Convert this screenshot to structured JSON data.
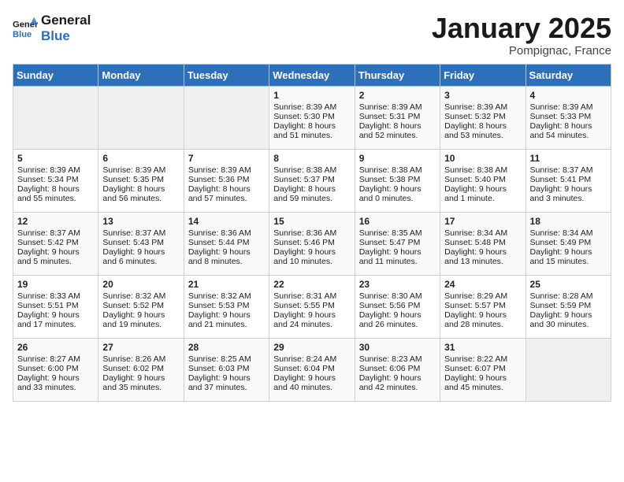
{
  "header": {
    "logo_line1": "General",
    "logo_line2": "Blue",
    "month": "January 2025",
    "location": "Pompignac, France"
  },
  "days_of_week": [
    "Sunday",
    "Monday",
    "Tuesday",
    "Wednesday",
    "Thursday",
    "Friday",
    "Saturday"
  ],
  "weeks": [
    [
      {
        "day": "",
        "info": ""
      },
      {
        "day": "",
        "info": ""
      },
      {
        "day": "",
        "info": ""
      },
      {
        "day": "1",
        "info": "Sunrise: 8:39 AM\nSunset: 5:30 PM\nDaylight: 8 hours\nand 51 minutes."
      },
      {
        "day": "2",
        "info": "Sunrise: 8:39 AM\nSunset: 5:31 PM\nDaylight: 8 hours\nand 52 minutes."
      },
      {
        "day": "3",
        "info": "Sunrise: 8:39 AM\nSunset: 5:32 PM\nDaylight: 8 hours\nand 53 minutes."
      },
      {
        "day": "4",
        "info": "Sunrise: 8:39 AM\nSunset: 5:33 PM\nDaylight: 8 hours\nand 54 minutes."
      }
    ],
    [
      {
        "day": "5",
        "info": "Sunrise: 8:39 AM\nSunset: 5:34 PM\nDaylight: 8 hours\nand 55 minutes."
      },
      {
        "day": "6",
        "info": "Sunrise: 8:39 AM\nSunset: 5:35 PM\nDaylight: 8 hours\nand 56 minutes."
      },
      {
        "day": "7",
        "info": "Sunrise: 8:39 AM\nSunset: 5:36 PM\nDaylight: 8 hours\nand 57 minutes."
      },
      {
        "day": "8",
        "info": "Sunrise: 8:38 AM\nSunset: 5:37 PM\nDaylight: 8 hours\nand 59 minutes."
      },
      {
        "day": "9",
        "info": "Sunrise: 8:38 AM\nSunset: 5:38 PM\nDaylight: 9 hours\nand 0 minutes."
      },
      {
        "day": "10",
        "info": "Sunrise: 8:38 AM\nSunset: 5:40 PM\nDaylight: 9 hours\nand 1 minute."
      },
      {
        "day": "11",
        "info": "Sunrise: 8:37 AM\nSunset: 5:41 PM\nDaylight: 9 hours\nand 3 minutes."
      }
    ],
    [
      {
        "day": "12",
        "info": "Sunrise: 8:37 AM\nSunset: 5:42 PM\nDaylight: 9 hours\nand 5 minutes."
      },
      {
        "day": "13",
        "info": "Sunrise: 8:37 AM\nSunset: 5:43 PM\nDaylight: 9 hours\nand 6 minutes."
      },
      {
        "day": "14",
        "info": "Sunrise: 8:36 AM\nSunset: 5:44 PM\nDaylight: 9 hours\nand 8 minutes."
      },
      {
        "day": "15",
        "info": "Sunrise: 8:36 AM\nSunset: 5:46 PM\nDaylight: 9 hours\nand 10 minutes."
      },
      {
        "day": "16",
        "info": "Sunrise: 8:35 AM\nSunset: 5:47 PM\nDaylight: 9 hours\nand 11 minutes."
      },
      {
        "day": "17",
        "info": "Sunrise: 8:34 AM\nSunset: 5:48 PM\nDaylight: 9 hours\nand 13 minutes."
      },
      {
        "day": "18",
        "info": "Sunrise: 8:34 AM\nSunset: 5:49 PM\nDaylight: 9 hours\nand 15 minutes."
      }
    ],
    [
      {
        "day": "19",
        "info": "Sunrise: 8:33 AM\nSunset: 5:51 PM\nDaylight: 9 hours\nand 17 minutes."
      },
      {
        "day": "20",
        "info": "Sunrise: 8:32 AM\nSunset: 5:52 PM\nDaylight: 9 hours\nand 19 minutes."
      },
      {
        "day": "21",
        "info": "Sunrise: 8:32 AM\nSunset: 5:53 PM\nDaylight: 9 hours\nand 21 minutes."
      },
      {
        "day": "22",
        "info": "Sunrise: 8:31 AM\nSunset: 5:55 PM\nDaylight: 9 hours\nand 24 minutes."
      },
      {
        "day": "23",
        "info": "Sunrise: 8:30 AM\nSunset: 5:56 PM\nDaylight: 9 hours\nand 26 minutes."
      },
      {
        "day": "24",
        "info": "Sunrise: 8:29 AM\nSunset: 5:57 PM\nDaylight: 9 hours\nand 28 minutes."
      },
      {
        "day": "25",
        "info": "Sunrise: 8:28 AM\nSunset: 5:59 PM\nDaylight: 9 hours\nand 30 minutes."
      }
    ],
    [
      {
        "day": "26",
        "info": "Sunrise: 8:27 AM\nSunset: 6:00 PM\nDaylight: 9 hours\nand 33 minutes."
      },
      {
        "day": "27",
        "info": "Sunrise: 8:26 AM\nSunset: 6:02 PM\nDaylight: 9 hours\nand 35 minutes."
      },
      {
        "day": "28",
        "info": "Sunrise: 8:25 AM\nSunset: 6:03 PM\nDaylight: 9 hours\nand 37 minutes."
      },
      {
        "day": "29",
        "info": "Sunrise: 8:24 AM\nSunset: 6:04 PM\nDaylight: 9 hours\nand 40 minutes."
      },
      {
        "day": "30",
        "info": "Sunrise: 8:23 AM\nSunset: 6:06 PM\nDaylight: 9 hours\nand 42 minutes."
      },
      {
        "day": "31",
        "info": "Sunrise: 8:22 AM\nSunset: 6:07 PM\nDaylight: 9 hours\nand 45 minutes."
      },
      {
        "day": "",
        "info": ""
      }
    ]
  ]
}
